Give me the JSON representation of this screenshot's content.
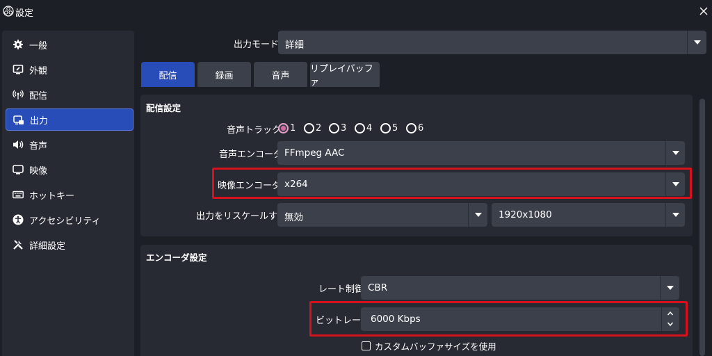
{
  "window": {
    "title": "設定",
    "close_icon": "close-icon"
  },
  "sidebar": {
    "items": [
      {
        "label": "一般",
        "icon": "gear-icon"
      },
      {
        "label": "外観",
        "icon": "appearance-icon"
      },
      {
        "label": "配信",
        "icon": "broadcast-icon"
      },
      {
        "label": "出力",
        "icon": "output-icon",
        "selected": true
      },
      {
        "label": "音声",
        "icon": "speaker-icon"
      },
      {
        "label": "映像",
        "icon": "monitor-icon"
      },
      {
        "label": "ホットキー",
        "icon": "keyboard-icon"
      },
      {
        "label": "アクセシビリティ",
        "icon": "accessibility-icon"
      },
      {
        "label": "詳細設定",
        "icon": "tools-icon"
      }
    ]
  },
  "output_mode": {
    "label": "出力モード",
    "value": "詳細"
  },
  "tabs": [
    {
      "label": "配信",
      "active": true
    },
    {
      "label": "録画"
    },
    {
      "label": "音声"
    },
    {
      "label": "リプレイバッファ"
    }
  ],
  "stream_settings": {
    "title": "配信設定",
    "audio_track": {
      "label": "音声トラック",
      "options": [
        "1",
        "2",
        "3",
        "4",
        "5",
        "6"
      ],
      "selected": "1"
    },
    "audio_encoder": {
      "label": "音声エンコーダ",
      "value": "FFmpeg AAC"
    },
    "video_encoder": {
      "label": "映像エンコーダ",
      "value": "x264"
    },
    "rescale": {
      "label": "出力をリスケールする",
      "value": "無効",
      "resolution": "1920x1080"
    }
  },
  "encoder_settings": {
    "title": "エンコーダ設定",
    "rate_control": {
      "label": "レート制御",
      "value": "CBR"
    },
    "bitrate": {
      "label": "ビットレート",
      "value": "6000 Kbps"
    },
    "custom_buffer": {
      "label": "カスタムバッファサイズを使用",
      "checked": false
    }
  },
  "colors": {
    "background": "#1d1f26",
    "panel": "#272a33",
    "control": "#3c404b",
    "accent": "#284cb8",
    "highlight": "#d8121d"
  }
}
